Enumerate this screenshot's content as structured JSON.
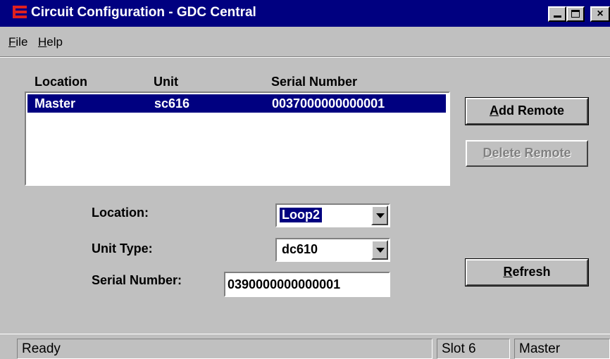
{
  "window": {
    "title": "Circuit Configuration - GDC Central",
    "colors": {
      "title_bar": "#000080",
      "selection": "#000080",
      "face": "#c0c0c0"
    },
    "controls": [
      "minimize-icon",
      "maximize-icon",
      "close-icon"
    ],
    "close_glyph": "×"
  },
  "menu": {
    "file": {
      "key": "F",
      "rest": "ile"
    },
    "help": {
      "key": "H",
      "rest": "elp"
    }
  },
  "list": {
    "columns": [
      "Location",
      "Unit",
      "Serial Number"
    ],
    "rows": [
      {
        "location": "Master",
        "unit": "sc616",
        "serial": "0037000000000001",
        "selected": true
      }
    ]
  },
  "buttons": {
    "add_remote": {
      "key": "A",
      "rest": "dd Remote",
      "enabled": true
    },
    "delete_remote": {
      "key": "D",
      "rest": "elete Remote",
      "enabled": false
    },
    "refresh": {
      "key": "R",
      "rest": "efresh",
      "enabled": true
    }
  },
  "form": {
    "location": {
      "label": "Location:",
      "value": "Loop2"
    },
    "unit_type": {
      "label": "Unit Type:",
      "value": "dc610"
    },
    "serial_number": {
      "label": "Serial Number:",
      "value": "0390000000000001"
    }
  },
  "status": {
    "message": "Ready",
    "slot": "Slot 6",
    "mode": "Master"
  }
}
